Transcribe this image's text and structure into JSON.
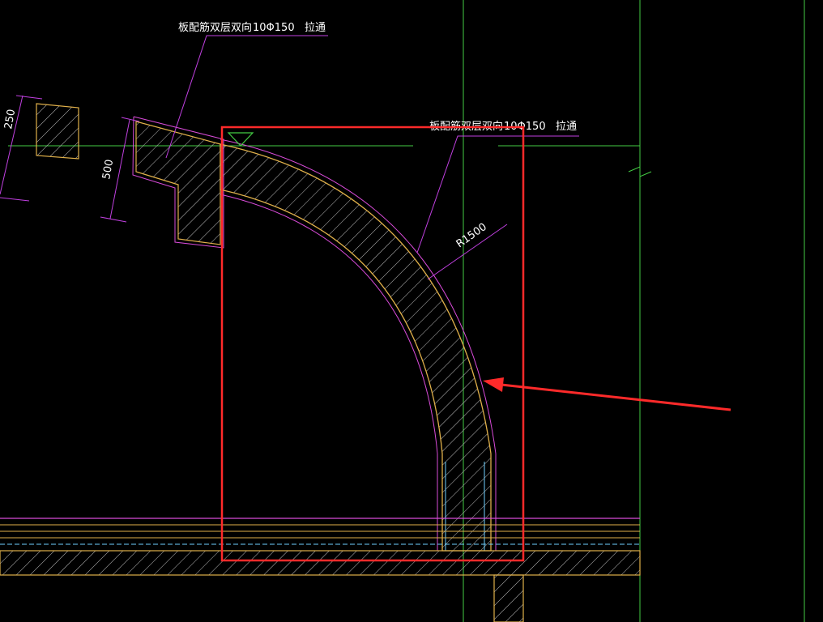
{
  "annotations": {
    "note_top": {
      "label": "板配筋双层双向",
      "spec": "10Φ150",
      "suffix": "拉通"
    },
    "note_right": {
      "label": "板配筋双层双向",
      "spec": "10Φ150",
      "suffix": "拉通"
    }
  },
  "dimensions": {
    "radius": "R1500",
    "depth_500": "500",
    "depth_250": "250"
  },
  "colors": {
    "background": "#000000",
    "concrete_outline": "#e0b04a",
    "waterproof_line": "#d84bd8",
    "leader_line": "#c040e0",
    "hatch": "#c8c8c8",
    "axis_line": "#44cc44",
    "highlight_box": "#ff2a2a",
    "pointer_arrow": "#ff2a2a",
    "text": "#ffffff"
  }
}
